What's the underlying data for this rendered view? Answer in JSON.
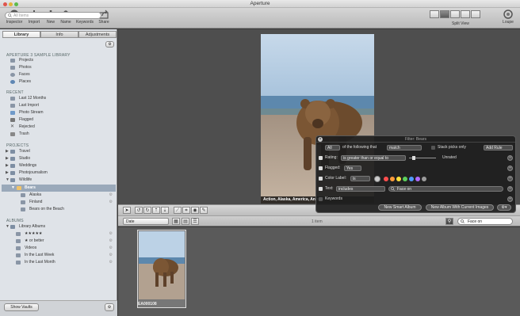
{
  "window": {
    "title": "Aperture"
  },
  "toolbar": {
    "buttons": [
      {
        "label": "Inspector",
        "icon": "info-icon"
      },
      {
        "label": "Import",
        "icon": "import-arrow-icon"
      },
      {
        "label": "New",
        "icon": "plus-icon"
      },
      {
        "label": "Name",
        "icon": "person-icon"
      },
      {
        "label": "Keywords",
        "icon": "tag-icon"
      },
      {
        "label": "Share",
        "icon": "share-arrow-icon"
      }
    ],
    "split_view_label": "Split View",
    "loupe_label": "Loupe"
  },
  "sidebar": {
    "tabs": [
      "Library",
      "Info",
      "Adjustments"
    ],
    "search_placeholder": "All Items",
    "library_header": "APERTURE 3 SAMPLE LIBRARY",
    "library_items": [
      "Projects",
      "Photos",
      "Faces",
      "Places"
    ],
    "recent_header": "RECENT",
    "recent_items": [
      "Last 12 Months",
      "Last Import",
      "Photo Stream",
      "Flagged",
      "Rejected",
      "Trash"
    ],
    "projects_header": "PROJECTS",
    "projects_items": [
      "Travel",
      "Studio",
      "Weddings",
      "Photojournalism",
      "Wildlife"
    ],
    "wildlife_children": [
      "Bears",
      "Alaska",
      "Finland",
      "Bears on the Beach"
    ],
    "albums_header": "ALBUMS",
    "albums_items": [
      "Library Albums",
      "★★★★★",
      "★ or better",
      "Videos",
      "In the Last Week",
      "In the Last Month"
    ],
    "show_vaults_label": "Show Vaults"
  },
  "viewer": {
    "caption": "Action, Alaska, America, Animal"
  },
  "sortbar": {
    "sort_by": "Date",
    "item_count": "1 item",
    "search_value": "Face on"
  },
  "thumbnail": {
    "name": "EA000108"
  },
  "filter_hud": {
    "title": "Filter: Bears",
    "match_scope": "All",
    "of_following_text": "of the following that",
    "match_value": "match",
    "stack_picks_label": "Stack picks only",
    "add_rule_label": "Add Rule",
    "rating_label": "Rating:",
    "rating_operator": "is greater than or equal to",
    "rating_value": "Unrated",
    "flagged_label": "Flagged:",
    "flagged_value": "Yes",
    "color_label_label": "Color Label:",
    "color_label_operator": "is",
    "color_swatches": [
      "#ff4e4e",
      "#ff9b3a",
      "#ffe03d",
      "#5bd05b",
      "#4f9bff",
      "#b06bff",
      "#9b9b9b"
    ],
    "text_label": "Text:",
    "text_operator": "includes",
    "text_value": "Face on",
    "keywords_label": "Keywords",
    "new_smart_album_label": "New Smart Album",
    "new_album_current_label": "New Album With Current Images"
  }
}
